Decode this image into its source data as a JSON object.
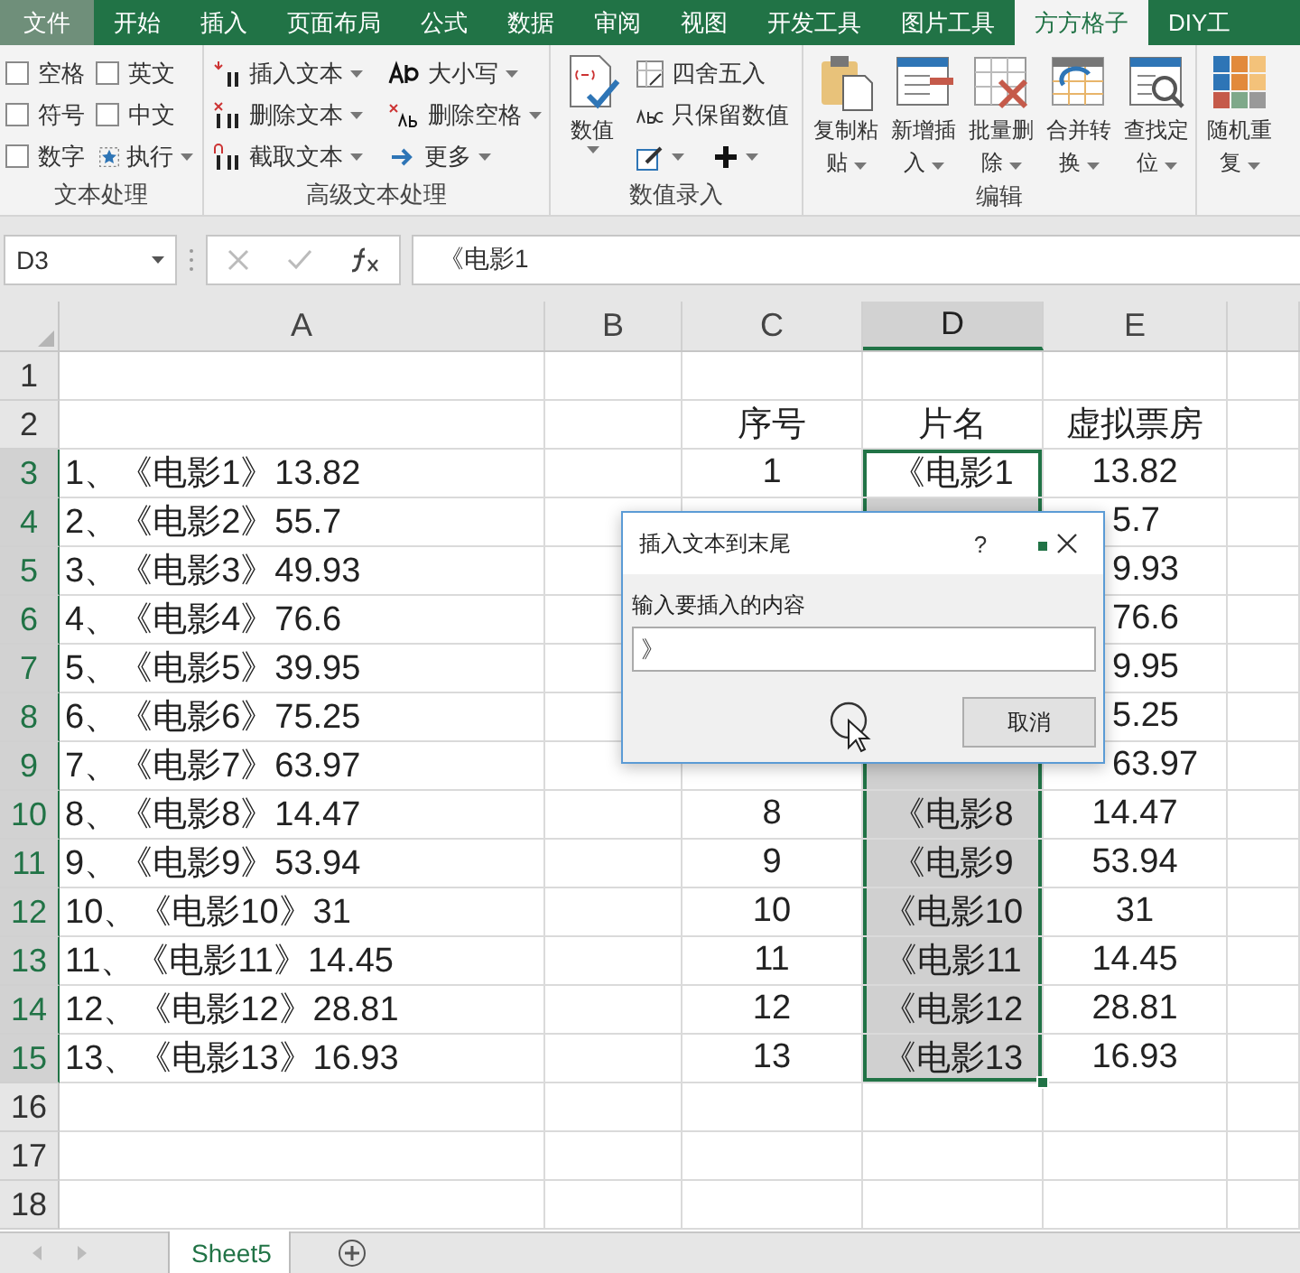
{
  "ribbon_tabs": [
    {
      "label": "文件",
      "kind": "file",
      "selected": false
    },
    {
      "label": "开始",
      "kind": "tab",
      "selected": false
    },
    {
      "label": "插入",
      "kind": "tab",
      "selected": false
    },
    {
      "label": "页面布局",
      "kind": "tab",
      "selected": false
    },
    {
      "label": "公式",
      "kind": "tab",
      "selected": false
    },
    {
      "label": "数据",
      "kind": "tab",
      "selected": false
    },
    {
      "label": "审阅",
      "kind": "tab",
      "selected": false
    },
    {
      "label": "视图",
      "kind": "tab",
      "selected": false
    },
    {
      "label": "开发工具",
      "kind": "tab",
      "selected": false
    },
    {
      "label": "图片工具",
      "kind": "tab",
      "selected": false
    },
    {
      "label": "方方格子",
      "kind": "tab",
      "selected": true
    },
    {
      "label": "DIY工",
      "kind": "tab",
      "selected": false
    }
  ],
  "ribbon_groups": [
    {
      "kind": "checkboxes",
      "label": "文本处理",
      "checkboxes": [
        {
          "label": "空格",
          "checked": false
        },
        {
          "label": "英文",
          "checked": false
        },
        {
          "label": "符号",
          "checked": false
        },
        {
          "label": "中文",
          "checked": false
        },
        {
          "label": "数字",
          "checked": false
        }
      ],
      "run_button": "执行"
    },
    {
      "kind": "small_buttons",
      "label": "高级文本处理",
      "buttons": [
        "插入文本",
        "删除文本",
        "截取文本",
        "大小写",
        "删除空格",
        "更多"
      ]
    },
    {
      "kind": "numbers",
      "label": "数值录入",
      "big_button": "数值",
      "buttons": [
        "四舍五入",
        "只保留数值"
      ]
    },
    {
      "kind": "big_buttons",
      "label": "编辑",
      "buttons": [
        "复制粘贴",
        "新增插入",
        "批量删除",
        "合并转换",
        "查找定位"
      ]
    },
    {
      "kind": "big_buttons",
      "buttons": [
        "随机重复"
      ]
    }
  ],
  "formula_bar": {
    "name_box": "D3",
    "formula": "《电影1"
  },
  "columns": [
    {
      "label": "A",
      "selected": false
    },
    {
      "label": "B",
      "selected": false
    },
    {
      "label": "C",
      "selected": false
    },
    {
      "label": "D",
      "selected": true
    },
    {
      "label": "E",
      "selected": false
    }
  ],
  "rows": [
    {
      "number": "1",
      "selected": false,
      "cells": {}
    },
    {
      "number": "2",
      "selected": false,
      "cells": {
        "c": "序号",
        "d": {
          "text": "片名",
          "selected": false
        },
        "e": "虚拟票房"
      }
    },
    {
      "number": "3",
      "selected": true,
      "cells": {
        "a": "1、《电影1》13.82",
        "c": "1",
        "d": {
          "text": "《电影1",
          "selected": true,
          "active": true
        },
        "e": "13.82"
      }
    },
    {
      "number": "4",
      "selected": true,
      "cells": {
        "a": "2、《电影2》55.7",
        "d": {
          "selected": true,
          "active": false
        },
        "e": "5.7"
      }
    },
    {
      "number": "5",
      "selected": true,
      "cells": {
        "a": "3、《电影3》49.93",
        "e": "9.93"
      }
    },
    {
      "number": "6",
      "selected": true,
      "cells": {
        "a": "4、《电影4》76.6",
        "e": "76.6"
      }
    },
    {
      "number": "7",
      "selected": true,
      "cells": {
        "a": "5、《电影5》39.95",
        "e": "9.95"
      }
    },
    {
      "number": "8",
      "selected": true,
      "cells": {
        "a": "6、《电影6》75.25",
        "e": "5.25"
      }
    },
    {
      "number": "9",
      "selected": true,
      "cells": {
        "a": "7、《电影7》63.97",
        "d": {
          "selected": true,
          "active": false
        },
        "e": "63.97"
      }
    },
    {
      "number": "10",
      "selected": true,
      "cells": {
        "a": "8、《电影8》14.47",
        "c": "8",
        "d": {
          "text": "《电影8",
          "selected": true,
          "active": false
        },
        "e": "14.47"
      }
    },
    {
      "number": "11",
      "selected": true,
      "cells": {
        "a": "9、《电影9》53.94",
        "c": "9",
        "d": {
          "text": "《电影9",
          "selected": true,
          "active": false
        },
        "e": "53.94"
      }
    },
    {
      "number": "12",
      "selected": true,
      "cells": {
        "a": "10、《电影10》31",
        "c": "10",
        "d": {
          "text": "《电影10",
          "selected": true,
          "active": false
        },
        "e": "31"
      }
    },
    {
      "number": "13",
      "selected": true,
      "cells": {
        "a": "11、《电影11》14.45",
        "c": "11",
        "d": {
          "text": "《电影11",
          "selected": true,
          "active": false
        },
        "e": "14.45"
      }
    },
    {
      "number": "14",
      "selected": true,
      "cells": {
        "a": "12、《电影12》28.81",
        "c": "12",
        "d": {
          "text": "《电影12",
          "selected": true,
          "active": false
        },
        "e": "28.81"
      }
    },
    {
      "number": "15",
      "selected": true,
      "cells": {
        "a": "13、《电影13》16.93",
        "c": "13",
        "d": {
          "text": "《电影13",
          "selected": true,
          "active": false
        },
        "e": "16.93"
      }
    },
    {
      "number": "16",
      "selected": false,
      "cells": {}
    },
    {
      "number": "17",
      "selected": false,
      "cells": {}
    },
    {
      "number": "18",
      "selected": false,
      "cells": {}
    }
  ],
  "sheet_tabs": [
    {
      "label": "Sheet5",
      "selected": true
    }
  ],
  "dialog": {
    "title": "插入文本到末尾",
    "help": "?",
    "prompt": "输入要插入的内容",
    "value": "》",
    "cancel": "取消"
  }
}
